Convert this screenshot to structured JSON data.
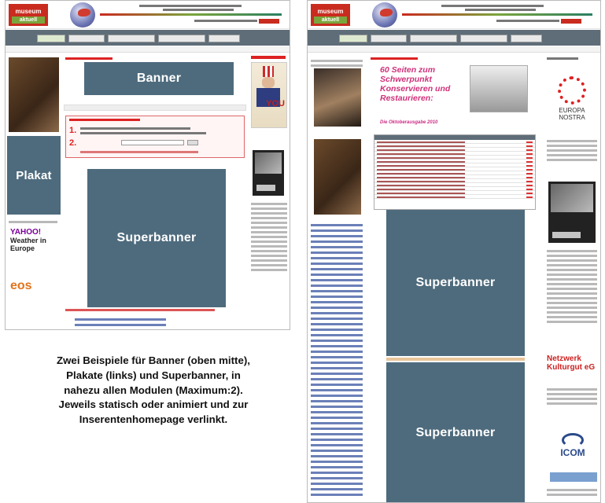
{
  "labels": {
    "banner": "Banner",
    "plakat": "Plakat",
    "superbanner_left": "Superbanner",
    "superbanner_right_top": "Superbanner",
    "superbanner_right_bottom": "Superbanner"
  },
  "caption": {
    "line1": "Zwei Beispiele für Banner (oben mitte),",
    "line2": "Plakate (links) und Superbanner, in",
    "line3": "nahezu allen Modulen (Maximum:2).",
    "line4": "Jeweils statisch oder animiert und zur",
    "line5": "Inserentenhomepage verlinkt."
  },
  "site": {
    "logo_top": "museum",
    "logo_bottom": "aktuell"
  },
  "left_page": {
    "sidebar_ad_brand": "YAHOO!",
    "sidebar_ad_title": "Weather in Europe",
    "sidebar_logo": "eos",
    "poster_word": "YOU"
  },
  "right_page": {
    "headline": "60 Seiten zum Schwerpunkt Konservieren und Restaurieren:",
    "subheadline": "Die Oktoberausgabe 2010",
    "europa_nostra": "EUROPA NOSTRA",
    "netzwerk": "Netzwerk Kulturgut eG",
    "icom": "ICOM"
  },
  "colors": {
    "ad_placeholder": "#4e6b7d",
    "nav": "#5e6d78",
    "accent_red": "#c92b1f"
  }
}
